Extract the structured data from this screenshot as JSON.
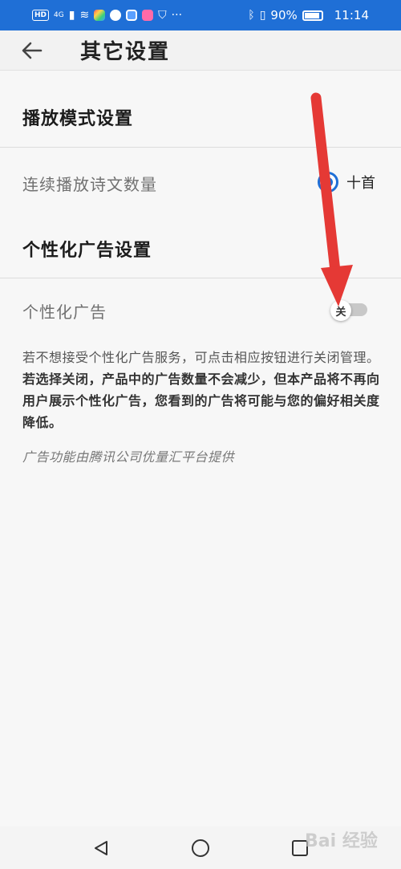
{
  "status_bar": {
    "network_badge": "HD",
    "signal_text": "4G",
    "battery_percent": "90%",
    "time": "11:14"
  },
  "header": {
    "title": "其它设置"
  },
  "sections": {
    "playback": {
      "title": "播放模式设置",
      "row_label": "连续播放诗文数量",
      "selected_option": "十首"
    },
    "ads": {
      "title": "个性化广告设置",
      "row_label": "个性化广告",
      "toggle_state": "关"
    }
  },
  "description": {
    "plain": "若不想接受个性化广告服务，可点击相应按钮进行关闭管理。",
    "bold": "若选择关闭，产品中的广告数量不会减少，但本产品将不再向用户展示个性化广告，您看到的广告将可能与您的偏好相关度降低。"
  },
  "footnote": "广告功能由腾讯公司优量汇平台提供",
  "watermark": "Bai 经验",
  "colors": {
    "accent": "#1f6fd6",
    "annotation_arrow": "#e53935"
  }
}
